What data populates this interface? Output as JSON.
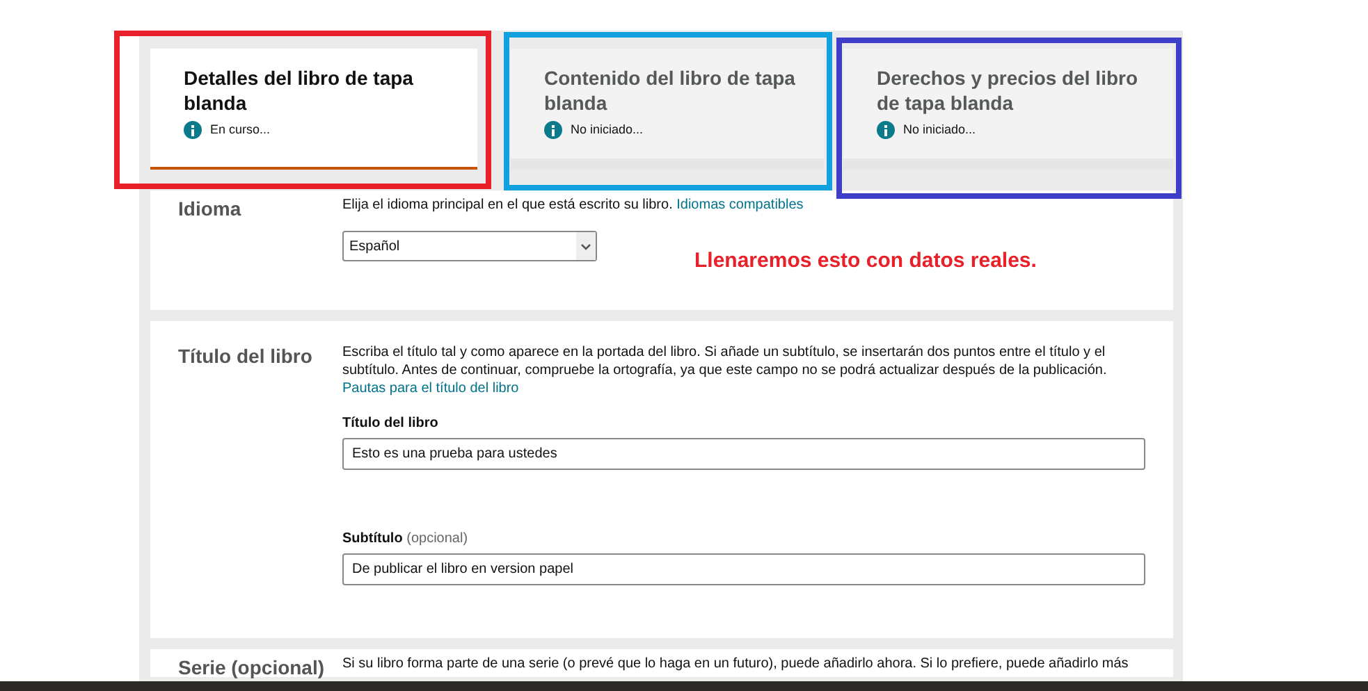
{
  "tabs": [
    {
      "title": "Detalles del libro de tapa blanda",
      "status": "En curso...",
      "selected": true
    },
    {
      "title": "Contenido del libro de tapa blanda",
      "status": "No iniciado...",
      "selected": false
    },
    {
      "title": "Derechos y precios del libro de tapa blanda",
      "status": "No iniciado...",
      "selected": false
    }
  ],
  "highlight_frames": [
    {
      "color": "#e8202a"
    },
    {
      "color": "#12a0e0"
    },
    {
      "color": "#3e3ec8"
    }
  ],
  "annotation": "Llenaremos esto con datos reales.",
  "sections": [
    {
      "kind": "select",
      "label": "Idioma",
      "description": "Elija el idioma principal en el que está escrito su libro.",
      "link": "Idiomas compatibles",
      "value": "Español"
    },
    {
      "kind": "fields",
      "label": "Título del libro",
      "description": "Escriba el título tal y como aparece en la portada del libro. Si añade un subtítulo, se insertarán dos puntos entre el título y el subtítulo. Antes de continuar, compruebe la ortografía, ya que este campo no se podrá actualizar después de la publicación.",
      "link": "Pautas para el título del libro",
      "fields": [
        {
          "label": "Título del libro",
          "value": "Esto es una prueba para ustedes"
        },
        {
          "label": "Subtítulo",
          "note": "(opcional)",
          "value": "De publicar el libro en version papel"
        }
      ]
    },
    {
      "kind": "text",
      "label": "Serie (opcional)",
      "description": "Si su libro forma parte de una serie (o prevé que lo haga en un futuro), puede añadirlo ahora. Si lo prefiere, puede añadirlo más"
    }
  ]
}
